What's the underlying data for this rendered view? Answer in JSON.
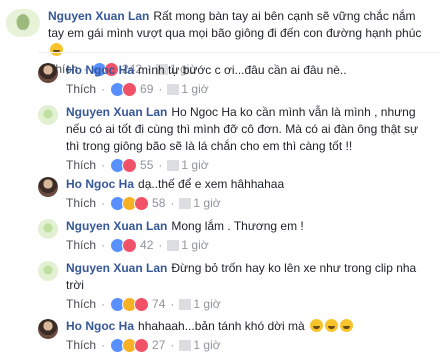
{
  "action_label": "Thích",
  "time_unit": "giờ",
  "comments": [
    {
      "author": "Nguyen Xuan Lan",
      "text": "Rất mong bàn tay ai bên cạnh sẽ vững chắc nắm tay em gái mình vượt qua mọi bão giông đi đến con đường hạnh phúc",
      "reaction_count": "242",
      "time": "1",
      "reactions": [
        "like",
        "love"
      ]
    },
    {
      "author": "Ho Ngoc Ha",
      "text": "mình tự bước c ơi...đâu cần ai đâu nè..",
      "reaction_count": "69",
      "time": "1",
      "reactions": [
        "like",
        "love"
      ]
    },
    {
      "author": "Nguyen Xuan Lan",
      "text": "Ho Ngoc Ha ko cần mình vẫn là mình , nhưng nếu có ai tốt đi cùng thì mình đỡ cô đơn. Mà có ai đàn ông thật sự thì trong giông bão sẽ là lá chắn cho em thì càng tốt !!",
      "reaction_count": "55",
      "time": "1",
      "reactions": [
        "like",
        "love"
      ]
    },
    {
      "author": "Ho Ngoc Ha",
      "text": "dạ..thế để e xem hâhhahaa",
      "reaction_count": "58",
      "time": "1",
      "reactions": [
        "like",
        "haha",
        "love"
      ]
    },
    {
      "author": "Nguyen Xuan Lan",
      "text": "Mong lắm . Thương em !",
      "reaction_count": "42",
      "time": "1",
      "reactions": [
        "like",
        "love"
      ]
    },
    {
      "author": "Nguyen Xuan Lan",
      "text": "Đừng bỏ trốn hay ko lên xe như trong clip nha trời",
      "reaction_count": "74",
      "time": "1",
      "reactions": [
        "like",
        "haha",
        "love"
      ]
    },
    {
      "author": "Ho Ngoc Ha",
      "text": "hhahaah...bản tánh khó dời mà",
      "reaction_count": "27",
      "time": "1",
      "reactions": [
        "like",
        "haha",
        "love"
      ]
    }
  ]
}
